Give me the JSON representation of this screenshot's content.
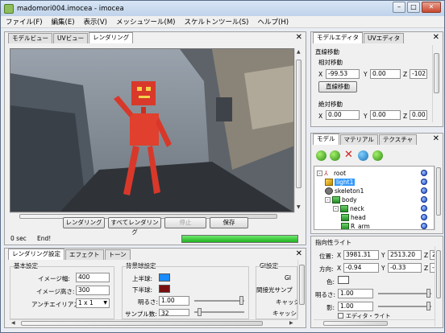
{
  "window": {
    "title": "madomori004.imocea - imocea",
    "buttons": {
      "minimize": "–",
      "maximize": "□",
      "close": "✕"
    }
  },
  "menu": [
    "ファイル(F)",
    "編集(E)",
    "表示(V)",
    "メッシュツール(M)",
    "スケルトンツール(S)",
    "ヘルプ(H)"
  ],
  "view_panel": {
    "tabs": [
      "モデルビュー",
      "UVビュー",
      "レンダリング"
    ],
    "active_tab": "レンダリング",
    "close_glyph": "✕",
    "buttons": {
      "render": "レンダリング",
      "render_all": "すべてレンダリング",
      "stop": "停止",
      "save": "保存"
    },
    "status_time": "0 sec",
    "status_msg": "End!",
    "progress": 1.0
  },
  "settings_panel": {
    "tabs": [
      "レンダリング設定",
      "エフェクト",
      "トーン"
    ],
    "close_glyph": "✕",
    "basic": {
      "heading": "基本設定",
      "image_width_label": "イメージ幅:",
      "image_width": "400",
      "image_height_label": "イメージ高さ:",
      "image_height": "300",
      "antialias_label": "アンチエイリアス:",
      "antialias": "1 x 1"
    },
    "background": {
      "heading": "背景球設定",
      "upper_label": "上半球:",
      "upper_color": "#1a8cff",
      "lower_label": "下半球:",
      "lower_color": "#7a0f0f",
      "brightness_label": "明るさ:",
      "brightness": "1.00",
      "samples_label": "サンプル数:",
      "samples": "32"
    },
    "gi": {
      "heading": "GI設定",
      "gi_label": "GI",
      "indirect_label": "間接光サンプ",
      "cache_label": "キャッシ",
      "cache2_label": "キャッシュ"
    }
  },
  "model_editor": {
    "tabs": [
      "モデルエディタ",
      "UVエディタ"
    ],
    "close_glyph": "✕",
    "heading": "直線移動",
    "relative_heading": "相対移動",
    "relative": {
      "x": "-99.53",
      "y": "0.00",
      "z": "-102"
    },
    "move_button": "直線移動",
    "absolute_heading": "絶対移動",
    "absolute": {
      "x": "0.00",
      "y": "0.00",
      "z": "0.00"
    },
    "axis_labels": {
      "x": "X",
      "y": "Y",
      "z": "Z"
    }
  },
  "model_panel": {
    "tabs": [
      "モデル",
      "マテリアル",
      "テクスチャ"
    ],
    "close_glyph": "✕",
    "tree": [
      {
        "label": "root",
        "icon": "bone",
        "indent": 0,
        "expander": "⊟"
      },
      {
        "label": "light1",
        "icon": "light",
        "indent": 1,
        "selected": true
      },
      {
        "label": "skeleton1",
        "icon": "skeleton",
        "indent": 1
      },
      {
        "label": "body",
        "icon": "mesh",
        "indent": 1,
        "expander": "⊟"
      },
      {
        "label": "neck",
        "icon": "mesh",
        "indent": 2,
        "expander": "⊟"
      },
      {
        "label": "head",
        "icon": "mesh",
        "indent": 3
      },
      {
        "label": "R_arm",
        "icon": "mesh",
        "indent": 3
      }
    ]
  },
  "light_panel": {
    "heading": "指向性ライト",
    "position_label": "位置:",
    "position": {
      "x": "3981.31",
      "y": "2513.20",
      "z": "2"
    },
    "direction_label": "方向:",
    "direction": {
      "x": "-0.94",
      "y": "-0.33",
      "z": "-0"
    },
    "color_label": "色:",
    "brightness_label": "明るさ:",
    "brightness": "1.00",
    "shadow_label": "影:",
    "shadow": "1.00",
    "extra_label": "エディタ・ライト"
  }
}
